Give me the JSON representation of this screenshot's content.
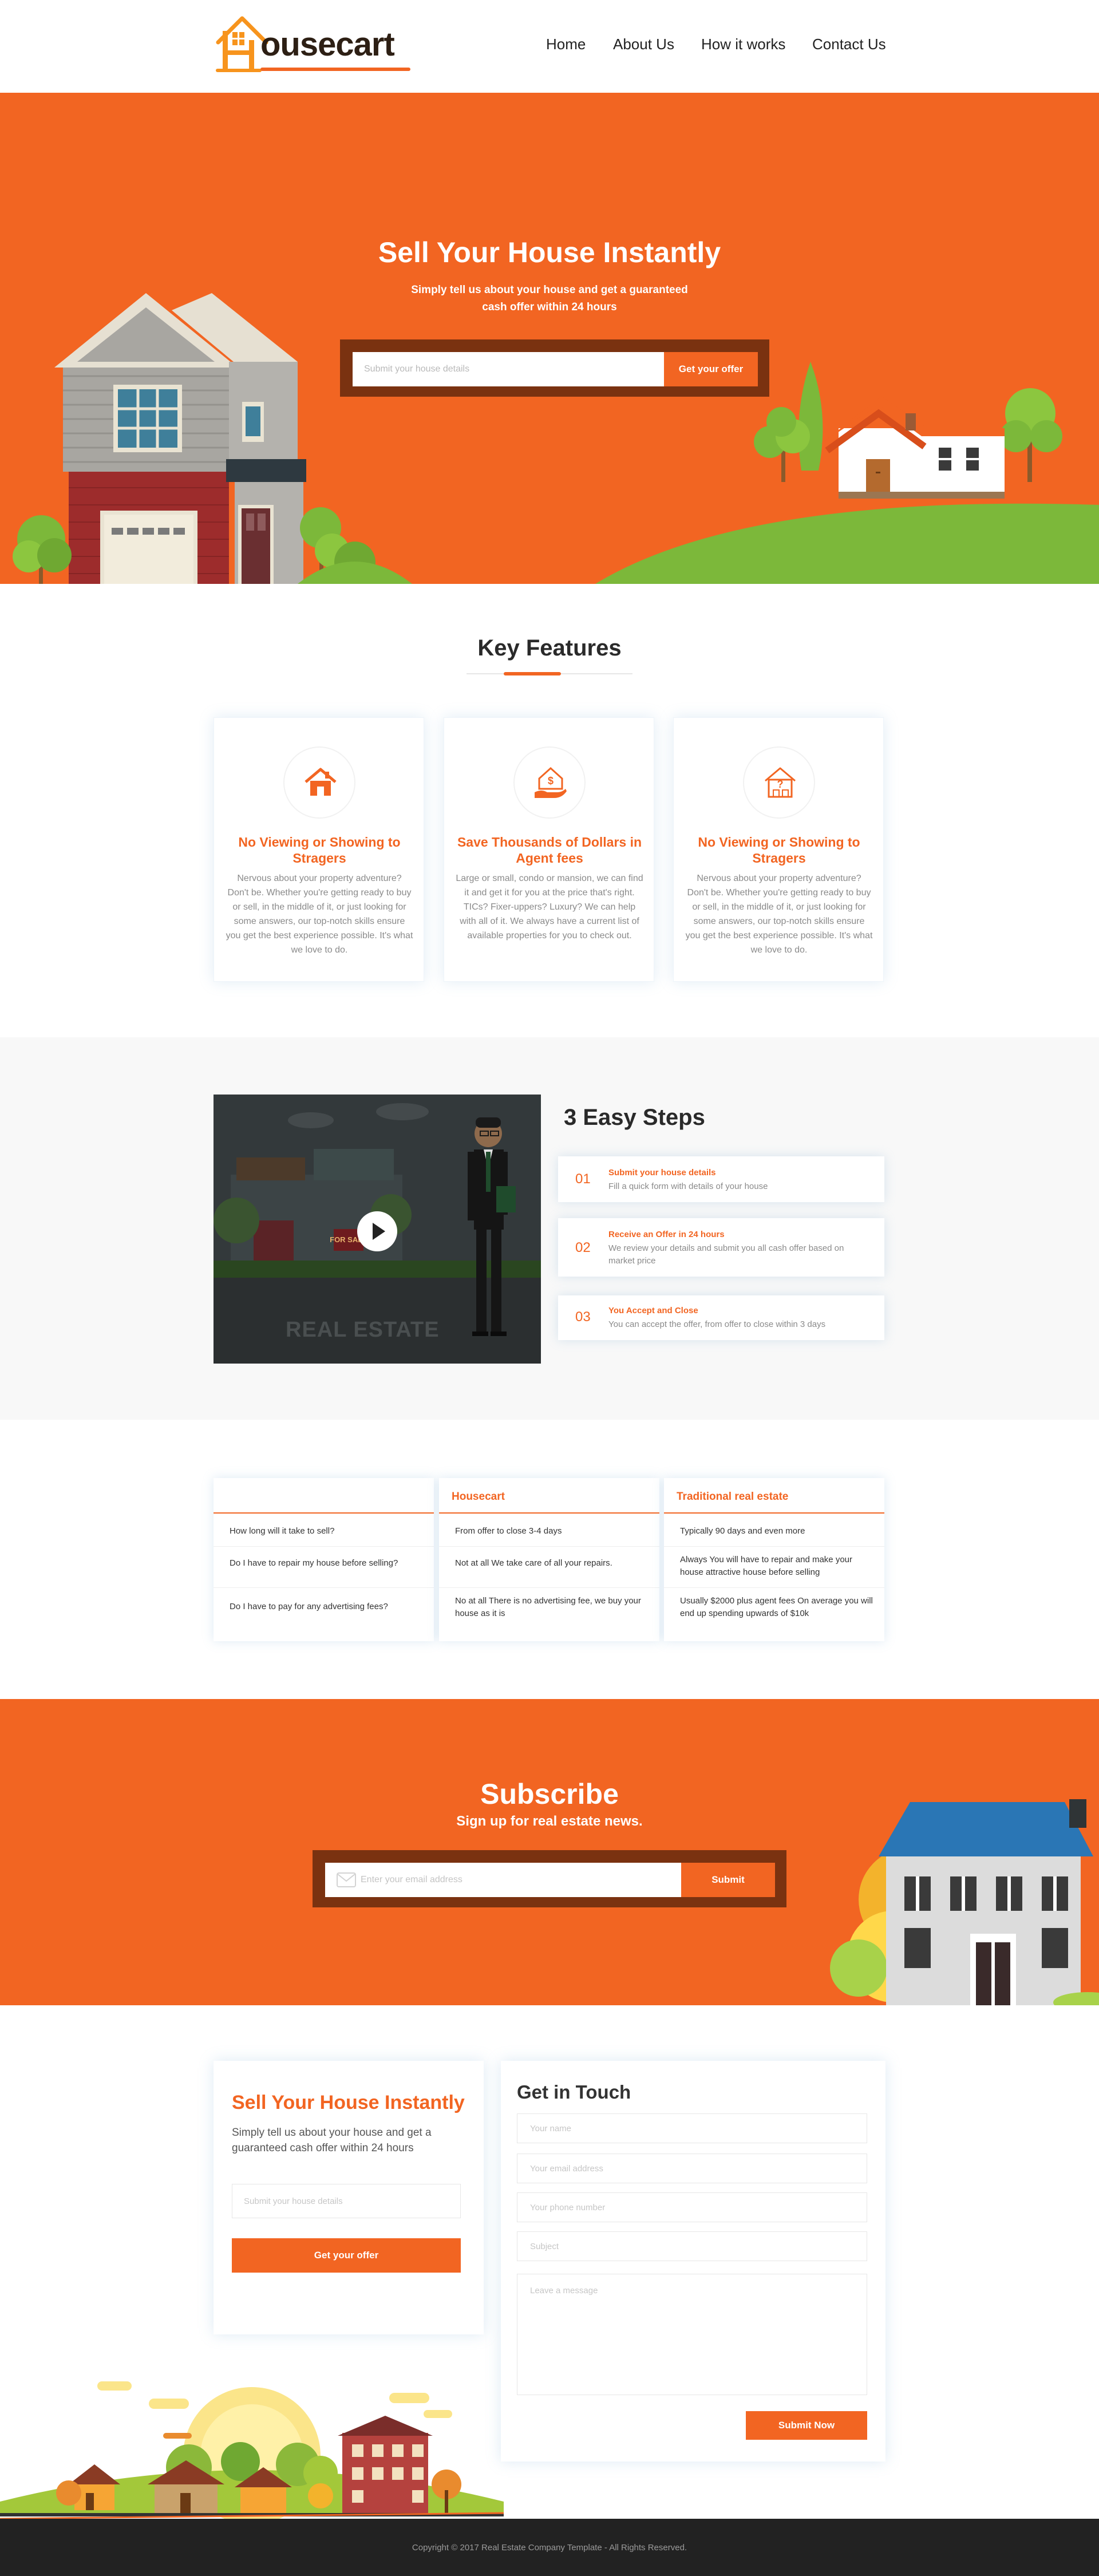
{
  "header": {
    "logo_text": "ousecart",
    "nav": [
      "Home",
      "About Us",
      "How it works",
      "Contact Us"
    ]
  },
  "hero": {
    "title": "Sell Your House Instantly",
    "subtitle_line1": "Simply tell us about your house and get a guaranteed",
    "subtitle_line2": "cash offer within 24 hours",
    "input_placeholder": "Submit your house details",
    "button_label": "Get your offer"
  },
  "features": {
    "title": "Key Features",
    "cards": [
      {
        "icon": "home-icon",
        "title": "No Viewing or Showing to Stragers",
        "text": "Nervous about your property adventure? Don't be. Whether you're getting ready to buy or sell, in the middle of it, or just looking for some answers, our top-notch skills ensure you get the best experience possible. It's what we love to do."
      },
      {
        "icon": "dollar-house-hand-icon",
        "title": "Save Thousands of Dollars in Agent fees",
        "text": "Large or small, condo or mansion, we can find it and get it for you at the price that's right. TICs? Fixer-uppers? Luxury? We can help with all of it. We always have a current list of available properties for you to check out."
      },
      {
        "icon": "question-house-icon",
        "title": "No Viewing or Showing to Stragers",
        "text": "Nervous about your property adventure? Don't be. Whether you're getting ready to buy or sell, in the middle of it, or just looking for some answers, our top-notch skills ensure you get the best experience possible. It's what we love to do."
      }
    ]
  },
  "steps": {
    "title": "3 Easy Steps",
    "video_label": "REAL ESTATE",
    "video_sign": "FOR SALE",
    "items": [
      {
        "num": "01",
        "title": "Submit your house details",
        "text": "Fill a quick form with details of your house"
      },
      {
        "num": "02",
        "title": "Receive an Offer in 24 hours",
        "text": "We review your details and submit you all cash offer based on market price"
      },
      {
        "num": "03",
        "title": "You Accept and Close",
        "text": "You can accept the offer, from offer to close within 3 days"
      }
    ]
  },
  "comparison": {
    "columns": [
      {
        "head": "",
        "rows": [
          "How long will it take to sell?",
          "Do I have to repair my house before selling?",
          "Do I have to pay for any advertising fees?"
        ]
      },
      {
        "head": "Housecart",
        "rows": [
          "From offer to close 3-4 days",
          "Not at all We take care of all your repairs.",
          "No at all There is no advertising fee, we buy your house as it is"
        ]
      },
      {
        "head": "Traditional real estate",
        "rows": [
          "Typically 90 days and even more",
          "Always You will  have to repair and make  your house attractive  house before selling",
          "Usually $2000 plus agent fees On average you will end up spending upwards of $10k"
        ]
      }
    ]
  },
  "subscribe": {
    "title": "Subscribe",
    "subtitle": "Sign up for real estate news.",
    "input_placeholder": "Enter your email address",
    "button_label": "Submit"
  },
  "sell_card": {
    "title": "Sell Your House Instantly",
    "subtitle": "Simply tell us about your house and get a guaranteed  cash offer within 24 hours",
    "input_placeholder": "Submit your house details",
    "button_label": "Get your offer"
  },
  "contact": {
    "title": "Get in Touch",
    "name_placeholder": "Your name",
    "email_placeholder": "Your email address",
    "phone_placeholder": "Your phone number",
    "subject_placeholder": "Subject",
    "message_placeholder": "Leave a message",
    "button_label": "Submit Now"
  },
  "footer": {
    "copyright": "Copyright © 2017 Real Estate Company Template - All Rights Reserved."
  },
  "colors": {
    "accent": "#f26522",
    "dark_brown": "#7a3210",
    "footer_bg": "#222222",
    "grass": "#7cb83a"
  }
}
